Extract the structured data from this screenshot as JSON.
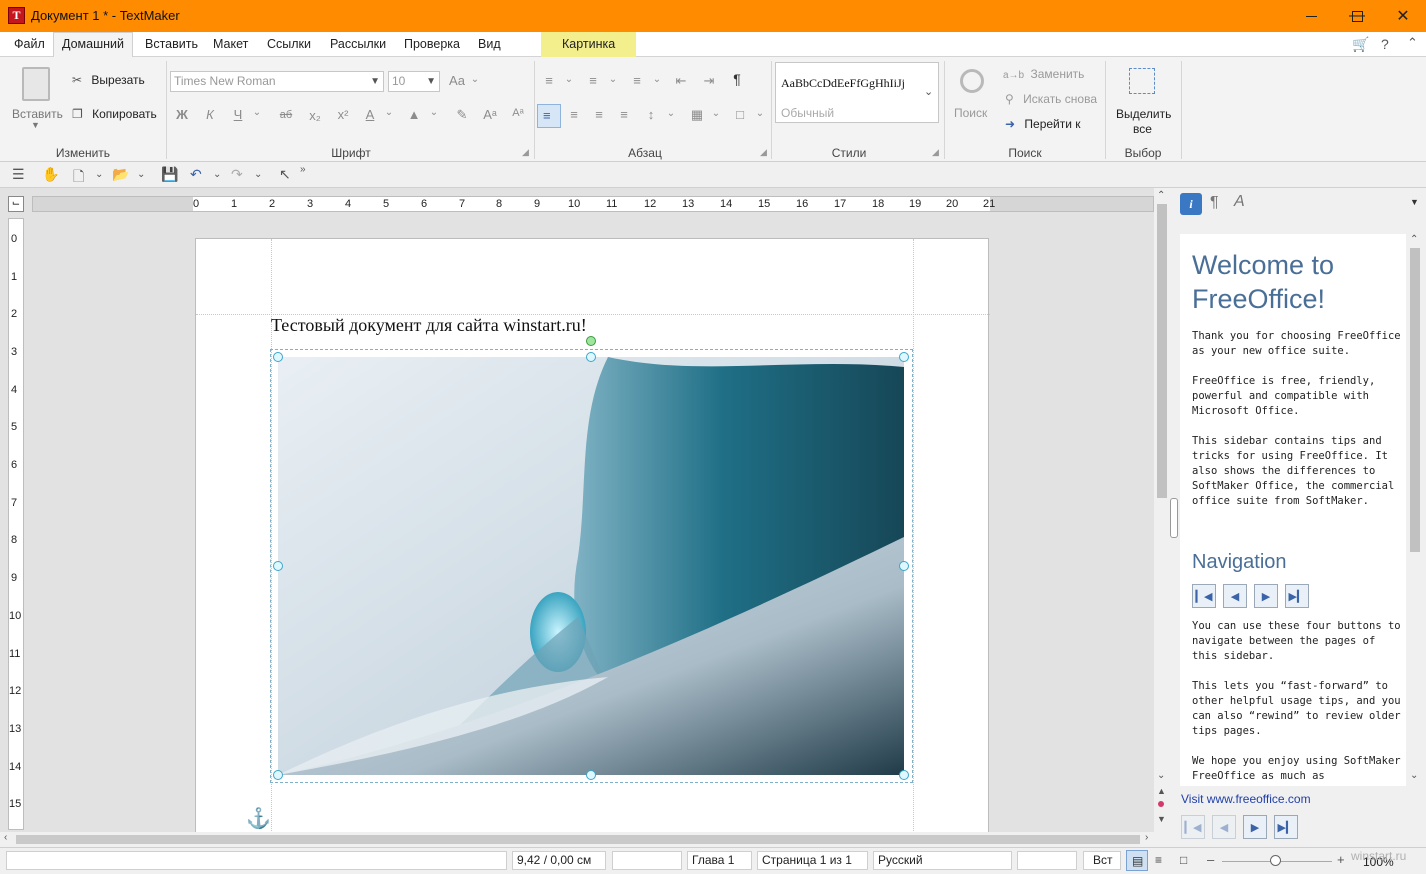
{
  "window": {
    "title": "Документ 1 * - TextMaker",
    "app_icon": "T"
  },
  "menu": {
    "items": [
      {
        "label": "Файл"
      },
      {
        "label": "Домашний"
      },
      {
        "label": "Вставить"
      },
      {
        "label": "Макет"
      },
      {
        "label": "Ссылки"
      },
      {
        "label": "Рассылки"
      },
      {
        "label": "Проверка"
      },
      {
        "label": "Вид"
      },
      {
        "label": "Картинка"
      }
    ],
    "help": "?"
  },
  "ribbon": {
    "edit": {
      "paste": "Вставить",
      "cut": "Вырезать",
      "copy": "Копировать",
      "group": "Изменить"
    },
    "font": {
      "name": "Times New Roman",
      "size": "10",
      "group": "Шрифт",
      "bold": "Ж",
      "italic": "К",
      "underline": "Ч",
      "strike": "аб",
      "sub": "x₂",
      "sup": "x²",
      "color": "А"
    },
    "paragraph": {
      "group": "Абзац",
      "pilcrow": "¶"
    },
    "styles": {
      "sample": "AaBbCcDdEeFfGgHhIiJj",
      "current": "Обычный",
      "group": "Стили"
    },
    "search": {
      "find": "Поиск",
      "replace": "Заменить",
      "find_again": "Искать снова",
      "goto": "Перейти к",
      "group": "Поиск"
    },
    "select": {
      "select_all_1": "Выделить",
      "select_all_2": "все",
      "group": "Выбор"
    }
  },
  "ruler": {
    "h_ticks": [
      "0",
      "1",
      "2",
      "3",
      "4",
      "5",
      "6",
      "7",
      "8",
      "9",
      "10",
      "11",
      "12",
      "13",
      "14",
      "15",
      "16",
      "17",
      "18",
      "19",
      "20",
      "21"
    ],
    "v_ticks": [
      "0",
      "1",
      "2",
      "3",
      "4",
      "5",
      "6",
      "7",
      "8",
      "9",
      "10",
      "11",
      "12",
      "13",
      "14",
      "15"
    ]
  },
  "document": {
    "text": "Тестовый документ для сайта winstart.ru!"
  },
  "sidebar": {
    "welcome_1": "Welcome to",
    "welcome_2": "FreeOffice!",
    "p1": "Thank you for choosing FreeOffice as your new office suite.",
    "p2": "FreeOffice is free, friendly, powerful and compatible with Microsoft Office.",
    "p3": "This sidebar contains tips and tricks for using FreeOffice. It also shows the differences to SoftMaker Office, the commercial office suite from SoftMaker.",
    "nav_title": "Navigation",
    "p4": "You can use these four buttons to navigate between the pages of this sidebar.",
    "p5": "This lets you “fast-forward” to other helpful usage tips, and you can also “rewind” to review older tips pages.",
    "p6": "We hope you enjoy using SoftMaker FreeOffice as much as",
    "visit": "Visit www.freeoffice.com"
  },
  "status": {
    "position": "9,42 / 0,00 см",
    "chapter": "Глава 1",
    "page": "Страница 1 из 1",
    "language": "Русский",
    "mode": "Вст",
    "zoom": "100%",
    "watermark": "winstart.ru"
  }
}
